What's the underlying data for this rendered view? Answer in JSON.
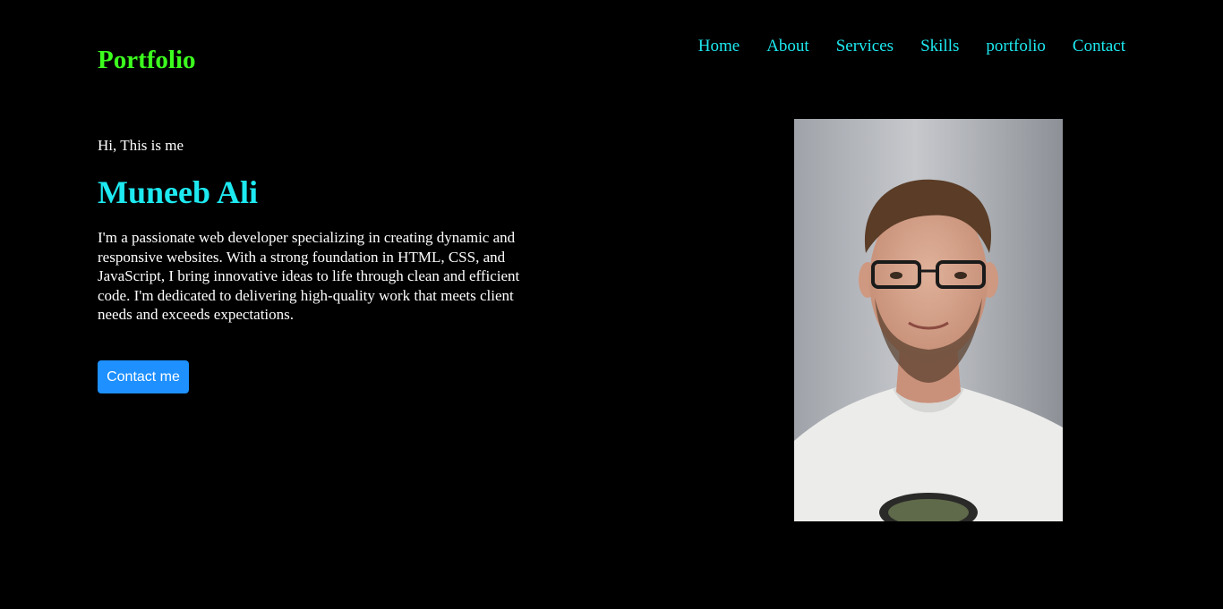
{
  "header": {
    "logo": "Portfolio",
    "nav": [
      "Home",
      "About",
      "Services",
      "Skills",
      "portfolio",
      "Contact"
    ]
  },
  "hero": {
    "greeting": "Hi, This is me",
    "name": "Muneeb Ali",
    "bio": "I'm a passionate web developer specializing in creating dynamic and responsive websites. With a strong foundation in HTML, CSS, and JavaScript, I bring innovative ideas to life through clean and efficient code. I'm dedicated to delivering high-quality work that meets client needs and exceeds expectations.",
    "cta_label": "Contact me"
  },
  "colors": {
    "background": "#000000",
    "logo": "#3cff1e",
    "accent": "#1de9f0",
    "button": "#1e90ff",
    "text": "#ffffff"
  }
}
